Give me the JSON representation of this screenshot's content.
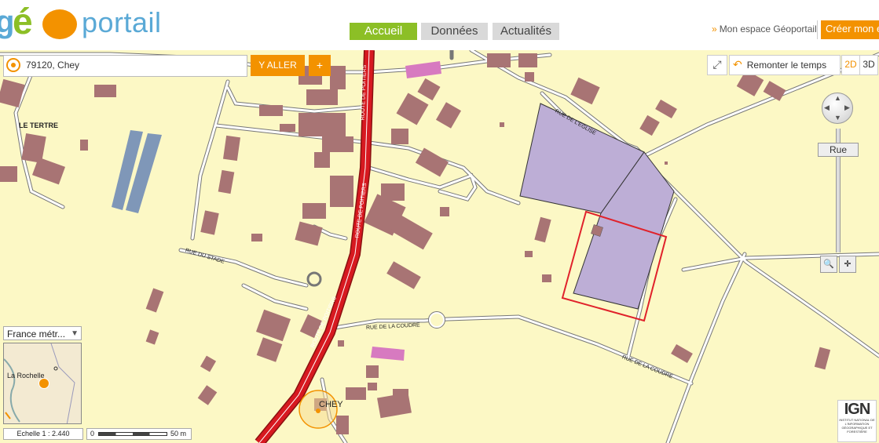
{
  "header": {
    "logo_text": "géoportail",
    "nav_tabs": [
      {
        "label": "Accueil",
        "active": true
      },
      {
        "label": "Données",
        "active": false
      },
      {
        "label": "Actualités",
        "active": false
      }
    ],
    "espace_link": "Mon espace Géoportail",
    "creer_button": "Créer mon e"
  },
  "search": {
    "value": "79120, Chey",
    "yaller_label": "Y ALLER",
    "plus_label": "+"
  },
  "toolbar": {
    "fullscreen_icon": "fullscreen-icon",
    "remonter_temps": "Remonter le temps",
    "view_2d": "2D",
    "view_3d": "3D",
    "zoom_level": "Rue"
  },
  "overview": {
    "select_value": "France métr...",
    "city_label": "La Rochelle"
  },
  "scale": {
    "echelle": "Echelle 1 :  2.440",
    "zero": "0",
    "distance": "50 m"
  },
  "ign": {
    "logo": "IGN",
    "text": "INSTITUT NATIONAL DE L'INFORMATION GÉOGRAPHIQUE ET FORESTIÈRE"
  },
  "map_labels": {
    "le_tertre": "LE TERTRE",
    "chey": "CHEY",
    "rue_eglise": "RUE DE L'EGLISE",
    "rue_stade": "RUE DU STADE",
    "rue_coudre_1": "RUE DE LA COUDRE",
    "rue_coudre_2": "RUE DE LA COUDRE",
    "route_poitiers_1": "ROUTE DE POITIERS",
    "route_poitiers_2": "ROUTE DE POITIERS",
    "route_poitiers_3": "ROUTE DE POITIERS"
  },
  "colors": {
    "brand_orange": "#f39200",
    "brand_green": "#8cbf26",
    "map_bg": "#fcf8c5",
    "building": "#a87474",
    "parcel": "#bdaed6",
    "selection": "#e0222b",
    "main_road": "#d71920"
  }
}
